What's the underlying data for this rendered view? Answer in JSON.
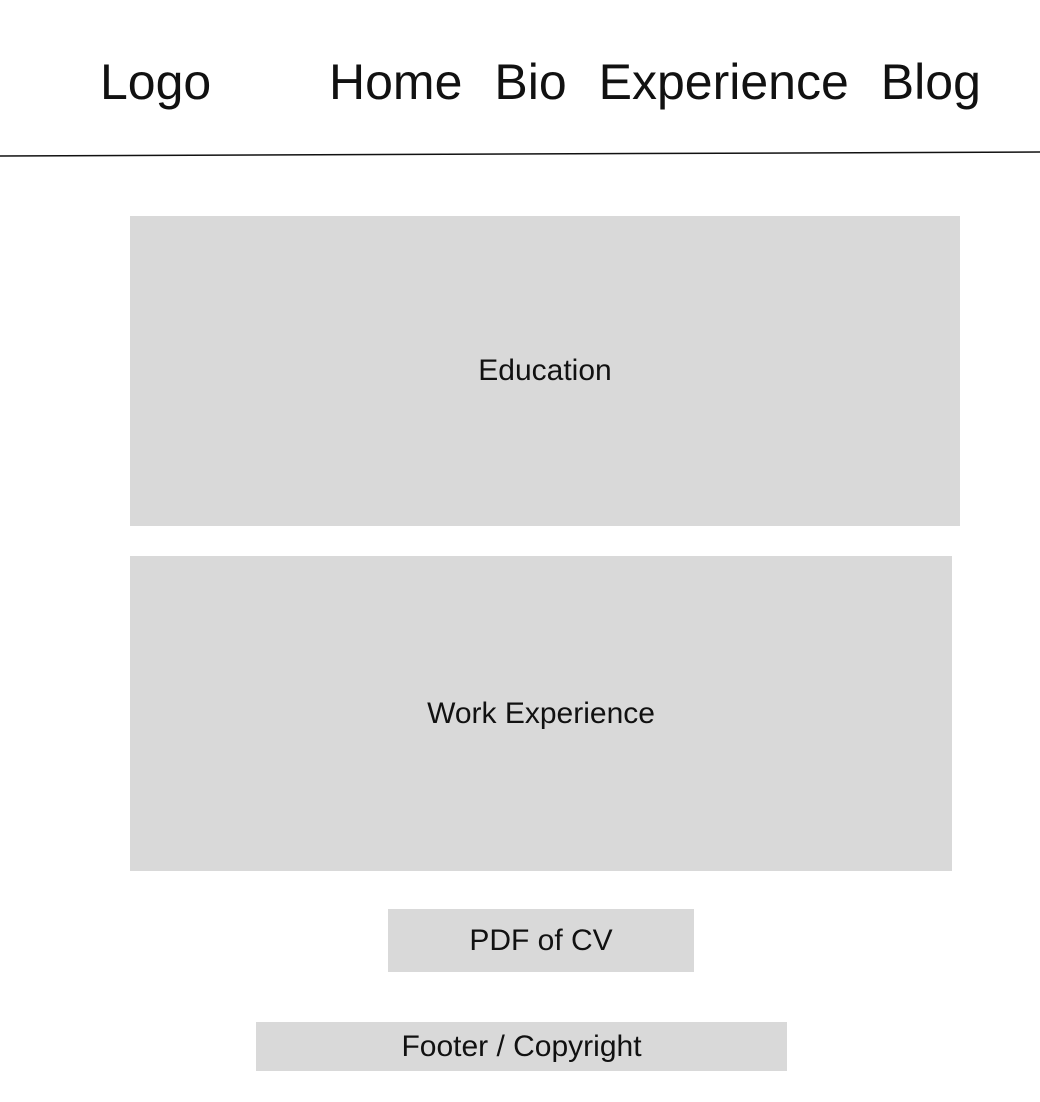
{
  "header": {
    "logo_text": "Logo",
    "nav": [
      {
        "label": "Home"
      },
      {
        "label": "Bio"
      },
      {
        "label": "Experience"
      },
      {
        "label": "Blog"
      }
    ]
  },
  "main": {
    "education_label": "Education",
    "work_label": "Work Experience",
    "pdf_label": "PDF of CV"
  },
  "footer": {
    "text": "Footer / Copyright"
  }
}
